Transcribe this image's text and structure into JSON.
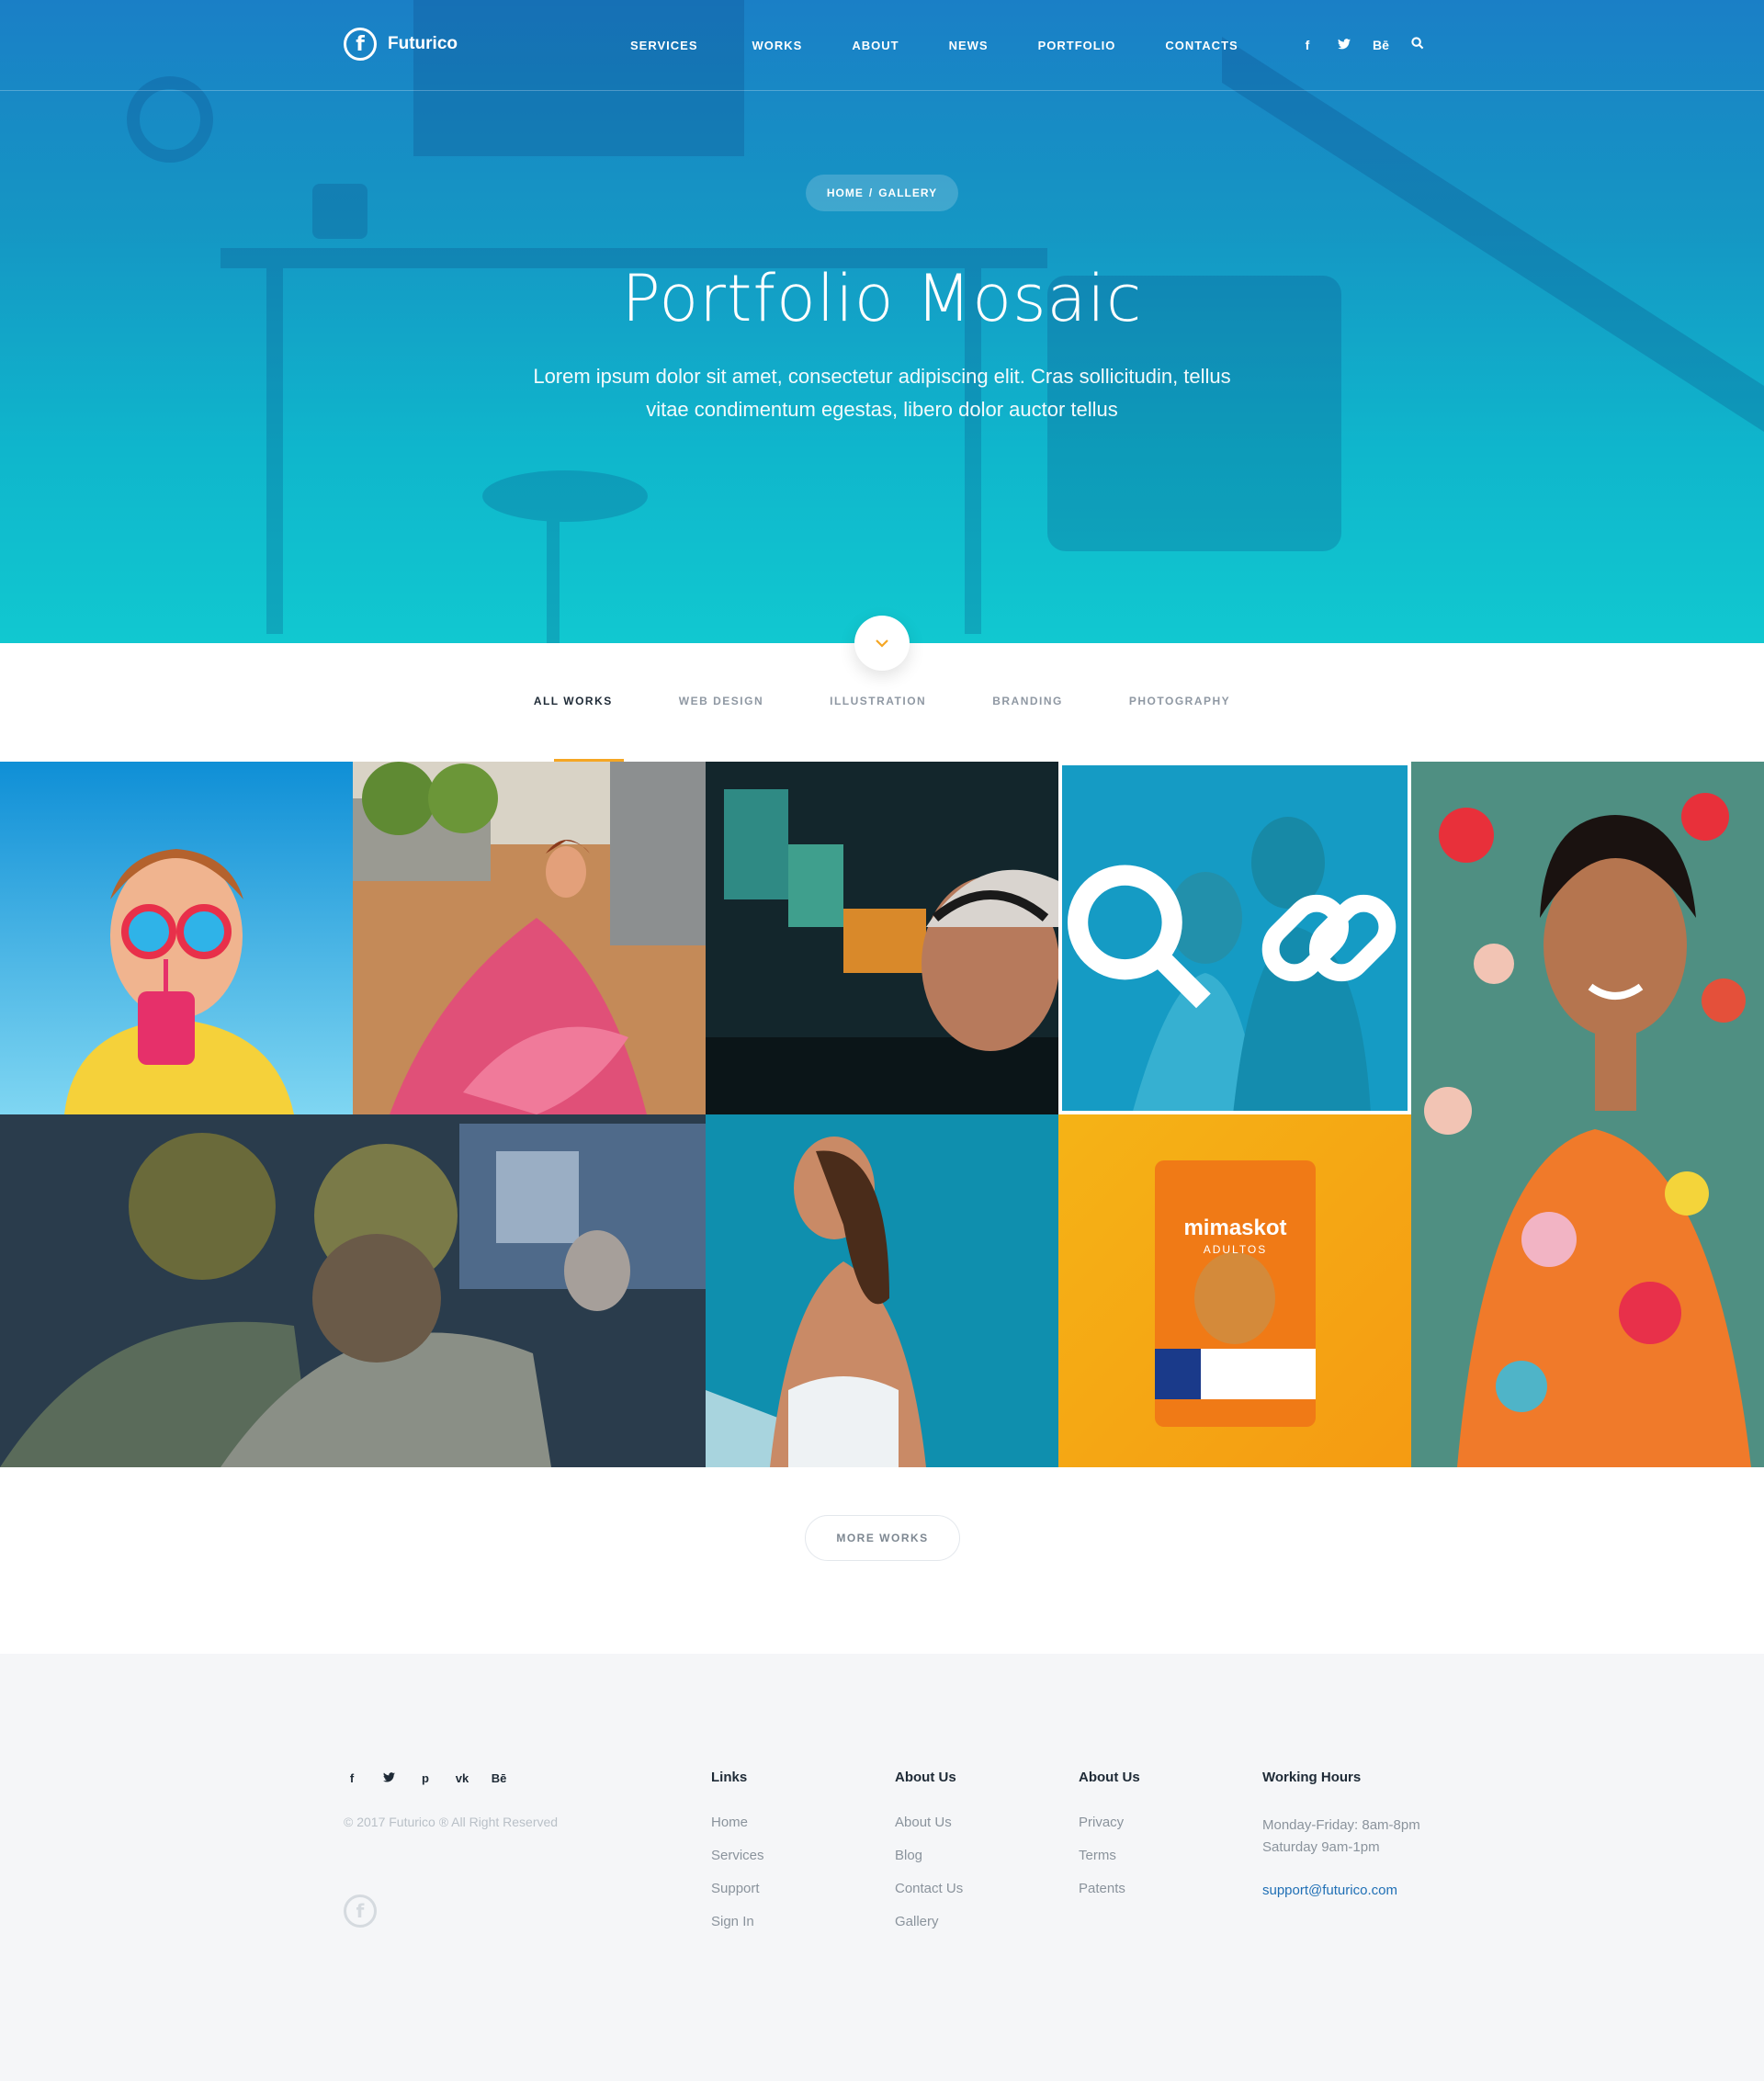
{
  "brand": {
    "name": "Futurico",
    "logo_glyph": "f"
  },
  "nav": {
    "items": [
      "SERVICES",
      "WORKS",
      "ABOUT",
      "NEWS",
      "PORTFOLIO",
      "CONTACTS"
    ],
    "social_icons": [
      "facebook-icon",
      "twitter-icon",
      "behance-icon",
      "search-icon"
    ],
    "social_glyphs": [
      "f",
      "t",
      "Bē",
      "⌕"
    ]
  },
  "hero": {
    "breadcrumb_home": "HOME",
    "breadcrumb_sep": "/",
    "breadcrumb_current": "GALLERY",
    "title": "Portfolio Mosaic",
    "description": "Lorem ipsum dolor sit amet, consectetur adipiscing elit. Cras sollicitudin, tellus vitae condimentum egestas, libero dolor auctor tellus",
    "bg_gradient": [
      "#1a7fc6",
      "#11c8d0"
    ]
  },
  "filters": {
    "items": [
      "ALL WORKS",
      "WEB DESIGN",
      "ILLUSTRATION",
      "BRANDING",
      "PHOTOGRAPHY"
    ],
    "active_index": 0,
    "accent": "#f5a623"
  },
  "portfolio": {
    "tiles": [
      {
        "name": "boy-with-sunglasses",
        "image": "photo"
      },
      {
        "name": "woman-in-pink-dress",
        "image": "photo"
      },
      {
        "name": "man-with-headset",
        "image": "photo"
      },
      {
        "name": "couple-at-beach",
        "image": "photo",
        "hover": true
      },
      {
        "name": "woman-floral-dress",
        "image": "photo"
      },
      {
        "name": "men-with-leaf-heads",
        "image": "photo"
      },
      {
        "name": "woman-in-pool",
        "image": "photo"
      },
      {
        "name": "dog-food-package",
        "image": "photo",
        "package_brand": "mimaskot",
        "package_sub": "ADULTOS"
      }
    ],
    "hover_icons": [
      "search-icon",
      "link-icon"
    ],
    "overlay_color": "#0ea4cc"
  },
  "more_button": "MORE WORKS",
  "footer": {
    "social_glyphs": [
      "f",
      "t",
      "p",
      "vk",
      "Bē"
    ],
    "copyright": "© 2017 Futurico ® All Right Reserved",
    "columns": [
      {
        "title": "Links",
        "items": [
          "Home",
          "Services",
          "Support",
          "Sign In"
        ]
      },
      {
        "title": "About Us",
        "items": [
          "About Us",
          "Blog",
          "Contact Us",
          "Gallery"
        ]
      },
      {
        "title": "About Us",
        "items": [
          "Privacy",
          "Terms",
          "Patents"
        ]
      }
    ],
    "hours": {
      "title": "Working Hours",
      "line1": "Monday-Friday: 8am-8pm",
      "line2": "Saturday 9am-1pm",
      "email": "support@futurico.com"
    }
  }
}
